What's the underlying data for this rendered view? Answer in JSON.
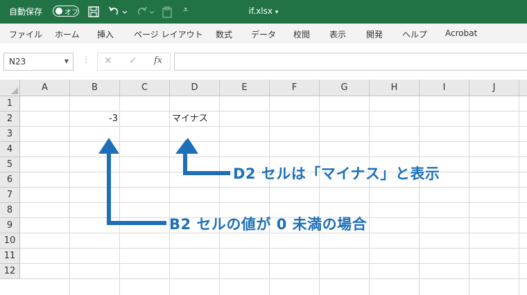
{
  "titlebar": {
    "autosave_label": "自動保存",
    "toggle_label": "オフ",
    "filename": "if.xlsx",
    "filename_caret": "▾",
    "customize_caret": "⩡"
  },
  "ribbon": {
    "tabs": [
      "ファイル",
      "ホーム",
      "挿入",
      "ページ レイアウト",
      "数式",
      "データ",
      "校閲",
      "表示",
      "開発",
      "ヘルプ",
      "Acrobat"
    ]
  },
  "formula_bar": {
    "name_box": "N23",
    "cancel_icon": "✕",
    "enter_icon": "✓",
    "fx_label": "fx",
    "formula_value": ""
  },
  "sheet": {
    "columns": [
      "A",
      "B",
      "C",
      "D",
      "E",
      "F",
      "G",
      "H",
      "I",
      "J"
    ],
    "rows": [
      "1",
      "2",
      "3",
      "4",
      "5",
      "6",
      "7",
      "8",
      "9",
      "10",
      "11",
      "12"
    ],
    "cells": {
      "B2": "-3",
      "D2": "マイナス"
    }
  },
  "annotations": {
    "d2_note": "D2 セルは「マイナス」と表示",
    "b2_note": "B2 セルの値が 0 未満の場合"
  },
  "colors": {
    "title_bar": "#217346",
    "annotation": "#1d6fb8"
  }
}
